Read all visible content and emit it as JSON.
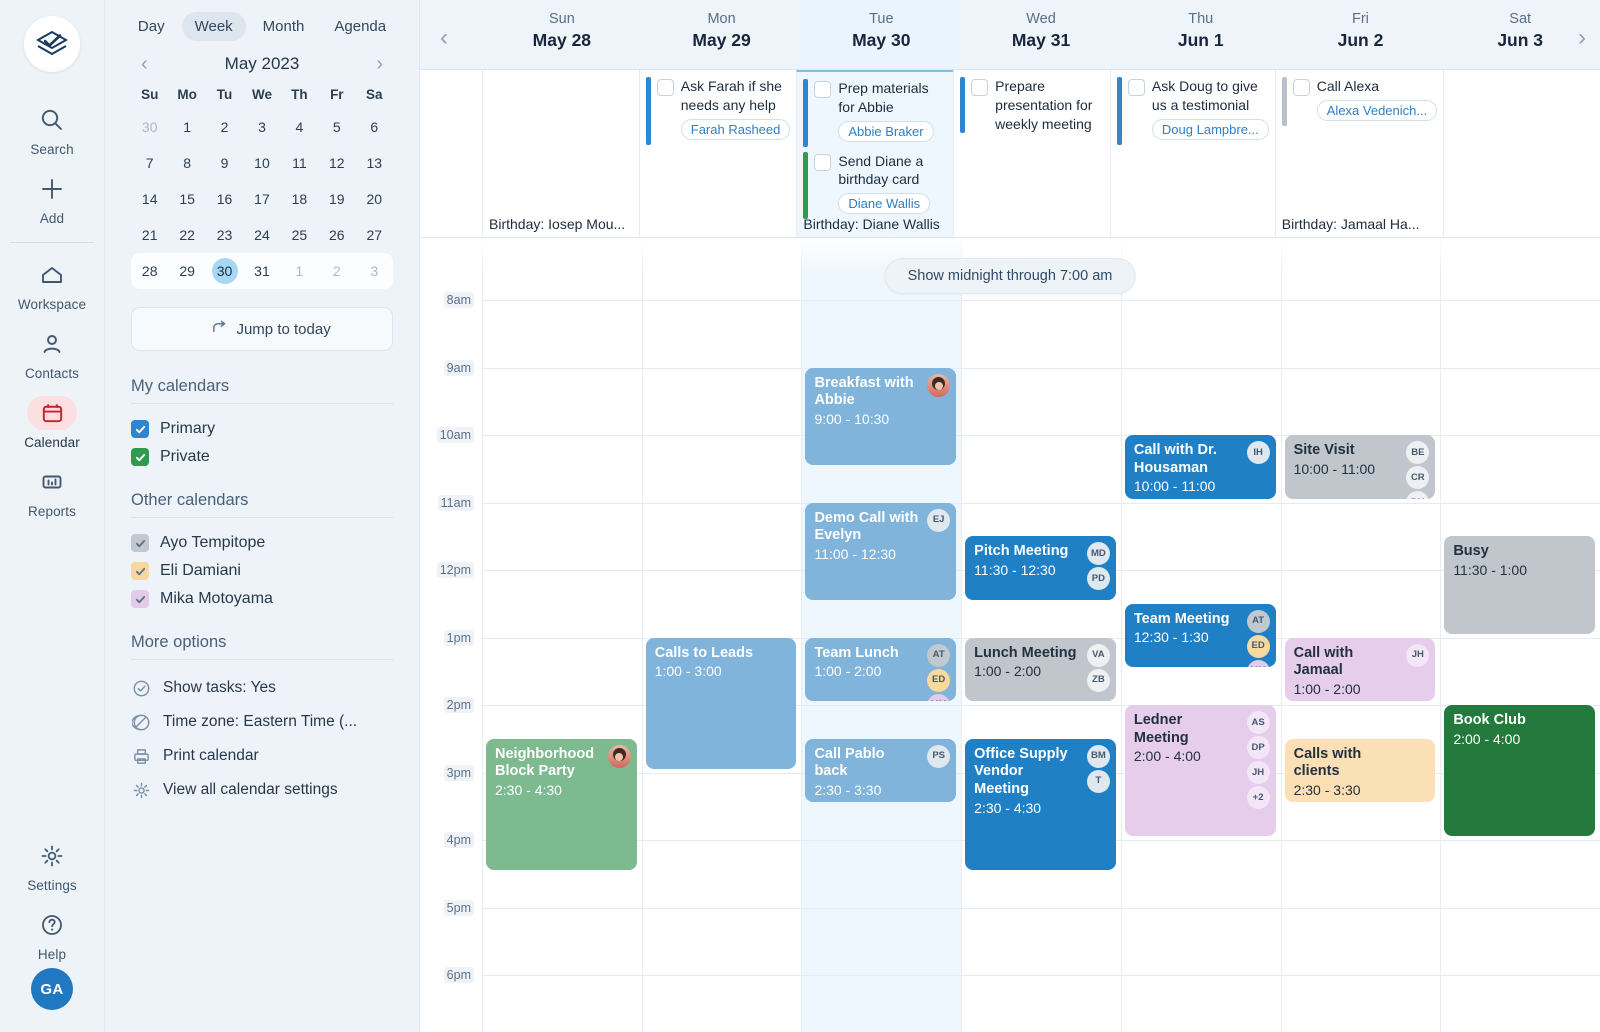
{
  "rail": {
    "logo_icon": "app-logo-icon",
    "items": [
      {
        "label": "Search",
        "icon": "search-icon"
      },
      {
        "label": "Add",
        "icon": "plus-icon"
      },
      {
        "label": "Workspace",
        "icon": "home-icon"
      },
      {
        "label": "Contacts",
        "icon": "person-icon"
      },
      {
        "label": "Calendar",
        "icon": "calendar-icon"
      },
      {
        "label": "Reports",
        "icon": "bar-chart-icon"
      },
      {
        "label": "Settings",
        "icon": "gear-icon"
      },
      {
        "label": "Help",
        "icon": "question-circle-icon"
      }
    ],
    "avatar_initials": "GA"
  },
  "panel": {
    "view_tabs": [
      "Day",
      "Week",
      "Month",
      "Agenda"
    ],
    "selected_view": "Week",
    "mini": {
      "title": "May 2023",
      "prev_icon": "chevron-left-icon",
      "next_icon": "chevron-right-icon",
      "weekdays": [
        "Su",
        "Mo",
        "Tu",
        "We",
        "Th",
        "Fr",
        "Sa"
      ],
      "weeks": [
        [
          {
            "d": "30",
            "mut": true
          },
          {
            "d": "1"
          },
          {
            "d": "2"
          },
          {
            "d": "3"
          },
          {
            "d": "4"
          },
          {
            "d": "5"
          },
          {
            "d": "6"
          }
        ],
        [
          {
            "d": "7"
          },
          {
            "d": "8"
          },
          {
            "d": "9"
          },
          {
            "d": "10"
          },
          {
            "d": "11"
          },
          {
            "d": "12"
          },
          {
            "d": "13"
          }
        ],
        [
          {
            "d": "14"
          },
          {
            "d": "15"
          },
          {
            "d": "16"
          },
          {
            "d": "17"
          },
          {
            "d": "18"
          },
          {
            "d": "19"
          },
          {
            "d": "20"
          }
        ],
        [
          {
            "d": "21"
          },
          {
            "d": "22"
          },
          {
            "d": "23"
          },
          {
            "d": "24"
          },
          {
            "d": "25"
          },
          {
            "d": "26"
          },
          {
            "d": "27"
          }
        ],
        [
          {
            "d": "28"
          },
          {
            "d": "29"
          },
          {
            "d": "30",
            "today": true
          },
          {
            "d": "31"
          },
          {
            "d": "1",
            "mut": true
          },
          {
            "d": "2",
            "mut": true
          },
          {
            "d": "3",
            "mut": true
          }
        ]
      ],
      "selected_week_index": 4
    },
    "jump_label": "Jump to today",
    "jump_icon": "arrow-jump-icon",
    "my_calendars_title": "My calendars",
    "my_calendars": [
      {
        "name": "Primary",
        "color": "#2f86cf",
        "checked": true
      },
      {
        "name": "Private",
        "color": "#2e9b4f",
        "checked": true
      }
    ],
    "other_calendars_title": "Other calendars",
    "other_calendars": [
      {
        "name": "Ayo Tempitope",
        "color": "#c0c8d0",
        "checked": true
      },
      {
        "name": "Eli Damiani",
        "color": "#f7d9a0",
        "checked": true
      },
      {
        "name": "Mika Motoyama",
        "color": "#e3cbe9",
        "checked": true
      }
    ],
    "more_options_title": "More options",
    "options": [
      {
        "label": "Show tasks: Yes",
        "icon": "check-circle-icon"
      },
      {
        "label": "Time zone: Eastern Time (...",
        "icon": "globe-icon"
      },
      {
        "label": "Print calendar",
        "icon": "printer-icon"
      },
      {
        "label": "View all calendar settings",
        "icon": "gear-icon"
      }
    ]
  },
  "calendar": {
    "prev_week_icon": "chevron-left-icon",
    "next_week_icon": "chevron-right-icon",
    "midnight_toggle": "Show midnight through 7:00 am",
    "time_labels": [
      "8am",
      "9am",
      "10am",
      "11am",
      "12pm",
      "1pm",
      "2pm",
      "3pm",
      "4pm",
      "5pm",
      "6pm"
    ],
    "days": [
      {
        "dow": "Sun",
        "date": "May 28",
        "today": false,
        "birthday": "Birthday: Iosep Mou...",
        "tasks": []
      },
      {
        "dow": "Mon",
        "date": "May 29",
        "today": false,
        "birthday": "",
        "tasks": [
          {
            "text": "Ask Farah if she needs any help",
            "contact": "Farah Rasheed",
            "bar": "#2f86cf",
            "checked": false
          }
        ]
      },
      {
        "dow": "Tue",
        "date": "May 30",
        "today": true,
        "birthday": "Birthday: Diane Wallis",
        "tasks": [
          {
            "text": "Prep materials for Abbie",
            "contact": "Abbie Braker",
            "bar": "#2f86cf",
            "checked": false
          },
          {
            "text": "Send Diane a birthday card",
            "contact": "Diane Wallis",
            "bar": "#2e9b4f",
            "checked": false
          }
        ]
      },
      {
        "dow": "Wed",
        "date": "May 31",
        "today": false,
        "birthday": "",
        "tasks": [
          {
            "text": "Prepare presentation for weekly meeting",
            "contact": "",
            "bar": "#2f86cf",
            "checked": false
          }
        ]
      },
      {
        "dow": "Thu",
        "date": "Jun 1",
        "today": false,
        "birthday": "",
        "tasks": [
          {
            "text": "Ask Doug to give us a testimonial",
            "contact": "Doug Lampbre...",
            "bar": "#2f86cf",
            "checked": false
          }
        ]
      },
      {
        "dow": "Fri",
        "date": "Jun 2",
        "today": false,
        "birthday": "Birthday: Jamaal Ha...",
        "tasks": [
          {
            "text": "Call Alexa",
            "contact": "Alexa Vedenich...",
            "bar": "#b9c2cb",
            "checked": false
          }
        ]
      },
      {
        "dow": "Sat",
        "date": "Jun 3",
        "today": false,
        "birthday": "",
        "tasks": []
      }
    ],
    "events": [
      {
        "day": 0,
        "title": "Neighborhood Block Party",
        "time": "2:30 - 4:30",
        "start": 14.5,
        "end": 16.5,
        "bg": "#7dba90",
        "text": "light_white",
        "avatars": [
          {
            "initials": "",
            "photo": true
          }
        ]
      },
      {
        "day": 1,
        "title": "Calls to Leads",
        "time": "1:00 - 3:00",
        "start": 13,
        "end": 15,
        "bg": "#81b4da",
        "text": "dark",
        "avatars": []
      },
      {
        "day": 2,
        "title": "Breakfast with Abbie",
        "time": "9:00 - 10:30",
        "start": 9,
        "end": 10.5,
        "bg": "#81b4da",
        "text": "dark",
        "avatars": [
          {
            "initials": "",
            "photo": true
          }
        ]
      },
      {
        "day": 2,
        "title": "Demo Call with Evelyn",
        "time": "11:00 - 12:30",
        "start": 11,
        "end": 12.5,
        "bg": "#81b4da",
        "text": "dark",
        "avatars": [
          {
            "initials": "EJ"
          }
        ]
      },
      {
        "day": 2,
        "title": "Team Lunch",
        "time": "1:00 - 2:00",
        "start": 13,
        "end": 14,
        "bg": "#81b4da",
        "text": "dark",
        "avatars": [
          {
            "initials": "AT",
            "bg": "#c0c8d0"
          },
          {
            "initials": "ED",
            "bg": "#f7d9a0"
          },
          {
            "initials": "MM",
            "bg": "#e3cbe9"
          }
        ]
      },
      {
        "day": 2,
        "title": "Call Pablo back",
        "time": "2:30 - 3:30",
        "start": 14.5,
        "end": 15.5,
        "bg": "#81b4da",
        "text": "dark",
        "avatars": [
          {
            "initials": "PS"
          }
        ]
      },
      {
        "day": 3,
        "title": "Pitch Meeting",
        "time": "11:30 - 12:30",
        "start": 11.5,
        "end": 12.5,
        "bg": "#2080c6",
        "text": "dark",
        "avatars": [
          {
            "initials": "MD"
          },
          {
            "initials": "PD"
          }
        ]
      },
      {
        "day": 3,
        "title": "Lunch Meeting",
        "time": "1:00 - 2:00",
        "start": 13,
        "end": 14,
        "bg": "#c0c6cc",
        "text": "light",
        "avatars": [
          {
            "initials": "VA",
            "bg": "#eef1f4"
          },
          {
            "initials": "ZB",
            "bg": "#eef1f4"
          }
        ]
      },
      {
        "day": 3,
        "title": "Office Supply Vendor Meeting",
        "time": "2:30 - 4:30",
        "start": 14.5,
        "end": 16.5,
        "bg": "#2080c6",
        "text": "dark",
        "avatars": [
          {
            "initials": "BM"
          },
          {
            "initials": "T"
          }
        ]
      },
      {
        "day": 4,
        "title": "Call with Dr. Housaman",
        "time": "10:00 - 11:00",
        "start": 10,
        "end": 11,
        "bg": "#2080c6",
        "text": "dark",
        "avatars": [
          {
            "initials": "IH"
          }
        ]
      },
      {
        "day": 4,
        "title": "Team Meeting",
        "time": "12:30 - 1:30",
        "start": 12.5,
        "end": 13.5,
        "bg": "#2080c6",
        "text": "dark",
        "avatars": [
          {
            "initials": "AT",
            "bg": "#c0c8d0"
          },
          {
            "initials": "ED",
            "bg": "#f7d9a0"
          },
          {
            "initials": "MM",
            "bg": "#e3cbe9"
          }
        ]
      },
      {
        "day": 4,
        "title": "Ledner Meeting",
        "time": "2:00 - 4:00",
        "start": 14,
        "end": 16,
        "bg": "#e6cdec",
        "text": "light",
        "avatars": [
          {
            "initials": "AS",
            "bg": "#f3e6f6"
          },
          {
            "initials": "DP",
            "bg": "#f3e6f6"
          },
          {
            "initials": "JH",
            "bg": "#f3e6f6"
          },
          {
            "initials": "+2",
            "bg": "#f3e6f6"
          }
        ]
      },
      {
        "day": 5,
        "title": "Site Visit",
        "time": "10:00 - 11:00",
        "start": 10,
        "end": 11,
        "bg": "#c0c6cc",
        "text": "light",
        "avatars": [
          {
            "initials": "BE",
            "bg": "#eef1f4"
          },
          {
            "initials": "CR",
            "bg": "#eef1f4"
          },
          {
            "initials": "DH",
            "bg": "#eef1f4"
          }
        ]
      },
      {
        "day": 5,
        "title": "Call with Jamaal",
        "time": "1:00 - 2:00",
        "start": 13,
        "end": 14,
        "bg": "#e6cdec",
        "text": "light",
        "avatars": [
          {
            "initials": "JH",
            "bg": "#f3e6f6"
          }
        ]
      },
      {
        "day": 5,
        "title": "Calls with clients",
        "time": "2:30 - 3:30",
        "start": 14.5,
        "end": 15.5,
        "bg": "#fae0b4",
        "text": "light",
        "avatars": []
      },
      {
        "day": 6,
        "title": "Busy",
        "time": "11:30 - 1:00",
        "start": 11.5,
        "end": 13,
        "bg": "#c0c6cc",
        "text": "light",
        "avatars": []
      },
      {
        "day": 6,
        "title": "Book Club",
        "time": "2:00 - 4:00",
        "start": 14,
        "end": 16,
        "bg": "#237a3c",
        "text": "dark",
        "avatars": []
      }
    ]
  }
}
